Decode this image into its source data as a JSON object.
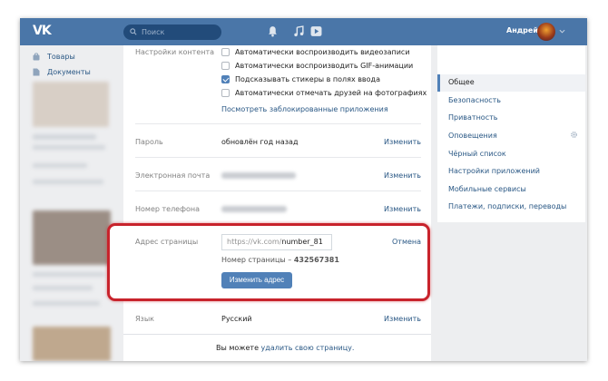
{
  "topbar": {
    "logo": "VK",
    "search_placeholder": "Поиск",
    "user_name": "Андрей"
  },
  "leftnav": {
    "items": [
      {
        "label": "Товары",
        "icon": "bag-icon"
      },
      {
        "label": "Документы",
        "icon": "document-icon"
      }
    ]
  },
  "settings": {
    "content_label": "Настройки контента",
    "options": [
      {
        "label": "Автоматически воспроизводить видеозаписи",
        "checked": false
      },
      {
        "label": "Автоматически воспроизводить GIF-анимации",
        "checked": false
      },
      {
        "label": "Подсказывать стикеры в полях ввода",
        "checked": true
      },
      {
        "label": "Автоматически отмечать друзей на фотографиях",
        "checked": false
      }
    ],
    "blocked_apps_link": "Посмотреть заблокированные приложения",
    "password": {
      "label": "Пароль",
      "value": "обновлён год назад",
      "action": "Изменить"
    },
    "email": {
      "label": "Электронная почта",
      "action": "Изменить"
    },
    "phone": {
      "label": "Номер телефона",
      "action": "Изменить"
    },
    "address": {
      "label": "Адрес страницы",
      "prefix": "https://vk.com/",
      "value": "number_81",
      "cancel": "Отмена",
      "page_number_label": "Номер страницы –",
      "page_number": "432567381",
      "change_button": "Изменить адрес"
    },
    "language": {
      "label": "Язык",
      "value": "Русский",
      "action": "Изменить"
    },
    "footer_prefix": "Вы можете",
    "footer_link": "удалить свою страницу."
  },
  "rightmenu": {
    "items": [
      {
        "label": "Общее",
        "active": true
      },
      {
        "label": "Безопасность",
        "active": false
      },
      {
        "label": "Приватность",
        "active": false
      },
      {
        "label": "Оповещения",
        "active": false
      },
      {
        "label": "Чёрный список",
        "active": false
      },
      {
        "label": "Настройки приложений",
        "active": false
      },
      {
        "label": "Мобильные сервисы",
        "active": false
      },
      {
        "label": "Платежи, подписки, переводы",
        "active": false
      }
    ]
  },
  "colors": {
    "header": "#4a76a8",
    "link": "#2a5885",
    "button": "#5181b8",
    "highlight": "#c8232c"
  }
}
